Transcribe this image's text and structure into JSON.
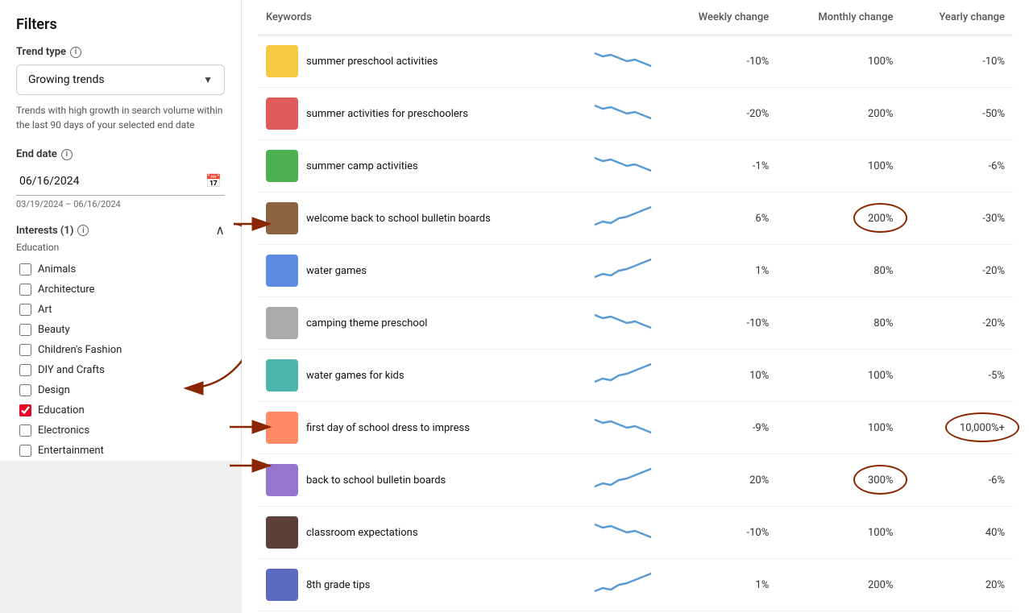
{
  "sidebar": {
    "title": "Filters",
    "trend_type_label": "Trend type",
    "trend_type_value": "Growing trends",
    "trend_description": "Trends with high growth in search volume within the last 90 days of your selected end date",
    "end_date_label": "End date",
    "end_date_value": "06/16/2024",
    "date_range": "03/19/2024 – 06/16/2024",
    "interests_label": "Interests (1)",
    "interests_sublabel": "Education",
    "interests_items": [
      {
        "label": "Animals",
        "checked": false
      },
      {
        "label": "Architecture",
        "checked": false
      },
      {
        "label": "Art",
        "checked": false
      },
      {
        "label": "Beauty",
        "checked": false
      },
      {
        "label": "Children's Fashion",
        "checked": false
      },
      {
        "label": "DIY and Crafts",
        "checked": false
      },
      {
        "label": "Design",
        "checked": false
      },
      {
        "label": "Education",
        "checked": true
      },
      {
        "label": "Electronics",
        "checked": false
      },
      {
        "label": "Entertainment",
        "checked": false
      }
    ]
  },
  "table": {
    "columns": [
      "Keywords",
      "",
      "Weekly change",
      "Monthly change",
      "Yearly change"
    ],
    "rows": [
      {
        "keyword": "summer preschool activities",
        "weekly": "-10%",
        "monthly": "100%",
        "yearly": "-10%",
        "circle_monthly": false,
        "circle_yearly": false,
        "thumb_color": "thumb-yellow"
      },
      {
        "keyword": "summer activities for preschoolers",
        "weekly": "-20%",
        "monthly": "200%",
        "yearly": "-50%",
        "circle_monthly": false,
        "circle_yearly": false,
        "thumb_color": "thumb-red"
      },
      {
        "keyword": "summer camp activities",
        "weekly": "-1%",
        "monthly": "100%",
        "yearly": "-6%",
        "circle_monthly": false,
        "circle_yearly": false,
        "thumb_color": "thumb-green"
      },
      {
        "keyword": "welcome back to school bulletin boards",
        "weekly": "6%",
        "monthly": "200%",
        "yearly": "-30%",
        "circle_monthly": true,
        "circle_yearly": false,
        "thumb_color": "thumb-brown"
      },
      {
        "keyword": "water games",
        "weekly": "1%",
        "monthly": "80%",
        "yearly": "-20%",
        "circle_monthly": false,
        "circle_yearly": false,
        "thumb_color": "thumb-blue"
      },
      {
        "keyword": "camping theme preschool",
        "weekly": "-10%",
        "monthly": "80%",
        "yearly": "-20%",
        "circle_monthly": false,
        "circle_yearly": false,
        "thumb_color": "thumb-gray"
      },
      {
        "keyword": "water games for kids",
        "weekly": "10%",
        "monthly": "100%",
        "yearly": "-5%",
        "circle_monthly": false,
        "circle_yearly": false,
        "thumb_color": "thumb-teal"
      },
      {
        "keyword": "first day of school dress to impress",
        "weekly": "-9%",
        "monthly": "100%",
        "yearly": "10,000%+",
        "circle_monthly": false,
        "circle_yearly": true,
        "thumb_color": "thumb-orange"
      },
      {
        "keyword": "back to school bulletin boards",
        "weekly": "20%",
        "monthly": "300%",
        "yearly": "-6%",
        "circle_monthly": true,
        "circle_yearly": false,
        "thumb_color": "thumb-purple"
      },
      {
        "keyword": "classroom expectations",
        "weekly": "-10%",
        "monthly": "100%",
        "yearly": "40%",
        "circle_monthly": false,
        "circle_yearly": false,
        "thumb_color": "thumb-dark"
      },
      {
        "keyword": "8th grade tips",
        "weekly": "1%",
        "monthly": "200%",
        "yearly": "20%",
        "circle_monthly": false,
        "circle_yearly": false,
        "thumb_color": "thumb-indigo"
      }
    ]
  }
}
